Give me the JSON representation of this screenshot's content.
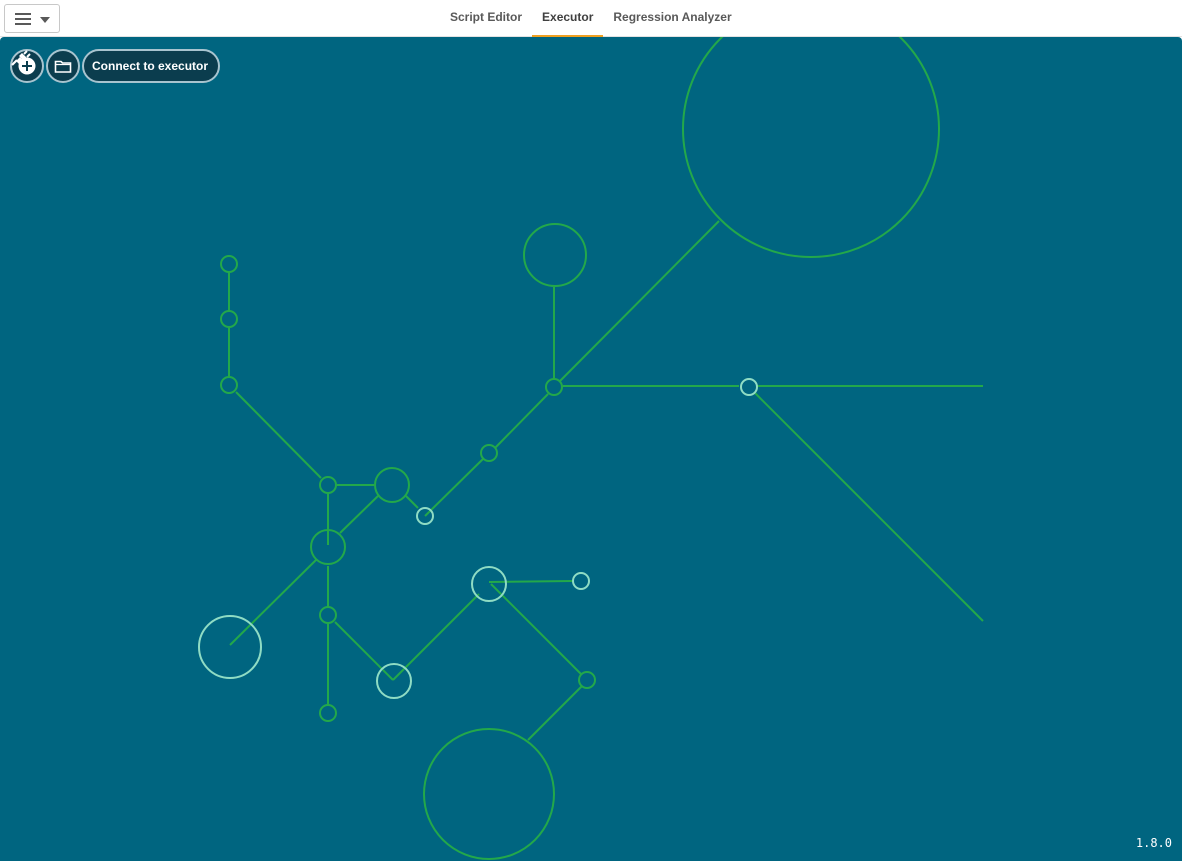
{
  "header": {
    "menu_icon": "hamburger-menu-icon",
    "tabs": [
      {
        "label": "Script Editor",
        "active": false
      },
      {
        "label": "Executor",
        "active": true
      },
      {
        "label": "Regression Analyzer",
        "active": false
      }
    ],
    "active_tab_color": "#f0a020"
  },
  "toolbar": {
    "add_icon": "plus-circle-icon",
    "open_icon": "folder-icon",
    "connect_label": "Connect to executor",
    "connect_icon": "plug-icon"
  },
  "canvas": {
    "background_color": "#006580",
    "node_color_green": "#23a84a",
    "node_color_pale": "#8fdcc4"
  },
  "version": "1.8.0"
}
